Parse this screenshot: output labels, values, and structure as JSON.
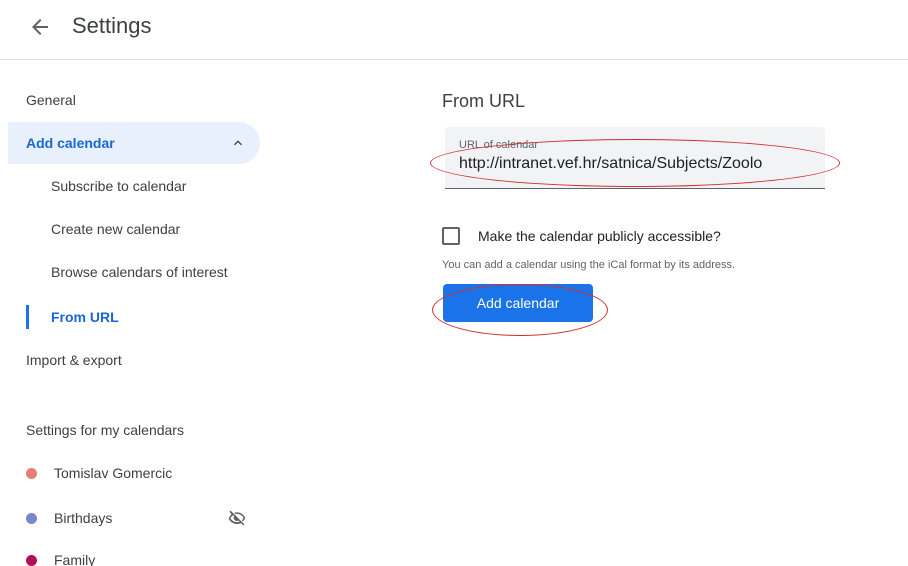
{
  "header": {
    "title": "Settings",
    "back_icon": "arrow-left-icon"
  },
  "sidebar": {
    "general": "General",
    "add_calendar": "Add calendar",
    "sub_items": [
      "Subscribe to calendar",
      "Create new calendar",
      "Browse calendars of interest",
      "From URL"
    ],
    "active_item": "From URL",
    "import_export": "Import & export",
    "section_title": "Settings for my calendars",
    "calendars": [
      {
        "name": "Tomislav Gomercic",
        "color": "#e67c73"
      },
      {
        "name": "Birthdays",
        "color": "#7986cb",
        "hidden": true
      },
      {
        "name": "Family",
        "color": "#ad1457"
      }
    ]
  },
  "main": {
    "heading": "From URL",
    "url_field": {
      "label": "URL of calendar",
      "value": "http://intranet.vef.hr/satnica/Subjects/Zoolo"
    },
    "checkbox_label": "Make the calendar publicly accessible?",
    "checkbox_checked": false,
    "helper_text": "You can add a calendar using the iCal format by its address.",
    "add_button": "Add calendar"
  },
  "colors": {
    "accent": "#1a73e8",
    "active_text": "#1967d2",
    "active_bg": "#e8f0fe",
    "annotation": "#d32f2f"
  }
}
